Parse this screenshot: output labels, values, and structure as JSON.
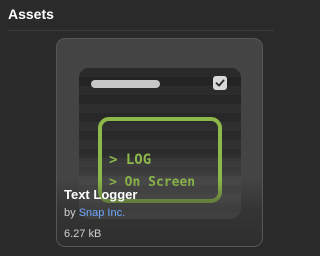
{
  "header": {
    "title": "Assets"
  },
  "card": {
    "thumbnail": {
      "line1": "> LOG",
      "line2": "> On Screen",
      "checkbox_icon": "checkmark-icon"
    },
    "name": "Text Logger",
    "author_prefix": "by",
    "author": "Snap Inc.",
    "size": "6.27 kB"
  },
  "colors": {
    "accent_green": "#8db84a",
    "link_blue": "#6fa8ff",
    "background": "#2a2a2a",
    "card_background": "#444444"
  }
}
